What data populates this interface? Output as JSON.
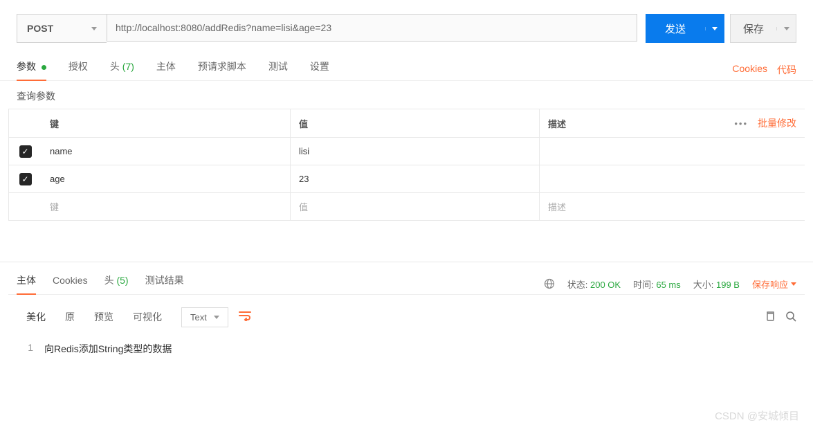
{
  "request": {
    "method": "POST",
    "url": "http://localhost:8080/addRedis?name=lisi&age=23",
    "send_label": "发送",
    "save_label": "保存"
  },
  "tabs": {
    "items": [
      {
        "label": "参数",
        "active": true,
        "dot": true
      },
      {
        "label": "授权"
      },
      {
        "label": "头",
        "count": "(7)"
      },
      {
        "label": "主体"
      },
      {
        "label": "预请求脚本"
      },
      {
        "label": "测试"
      },
      {
        "label": "设置"
      }
    ],
    "cookies_link": "Cookies",
    "code_link": "代码"
  },
  "query": {
    "title": "查询参数",
    "headers": {
      "key": "键",
      "value": "值",
      "desc": "描述",
      "bulk": "批量修改"
    },
    "rows": [
      {
        "checked": true,
        "key": "name",
        "value": "lisi"
      },
      {
        "checked": true,
        "key": "age",
        "value": "23"
      }
    ],
    "placeholders": {
      "key": "键",
      "value": "值",
      "desc": "描述"
    }
  },
  "response": {
    "tabs": [
      {
        "label": "主体",
        "active": true
      },
      {
        "label": "Cookies"
      },
      {
        "label": "头",
        "count": "(5)"
      },
      {
        "label": "测试结果"
      }
    ],
    "status_label": "状态:",
    "status_value": "200 OK",
    "time_label": "时间:",
    "time_value": "65 ms",
    "size_label": "大小:",
    "size_value": "199 B",
    "save_response": "保存响应"
  },
  "toolbar": {
    "buttons": [
      "美化",
      "原",
      "预览",
      "可视化"
    ],
    "format_label": "Text"
  },
  "body": {
    "line_no": "1",
    "content": "向Redis添加String类型的数据"
  },
  "watermark": "CSDN @安城倾目"
}
